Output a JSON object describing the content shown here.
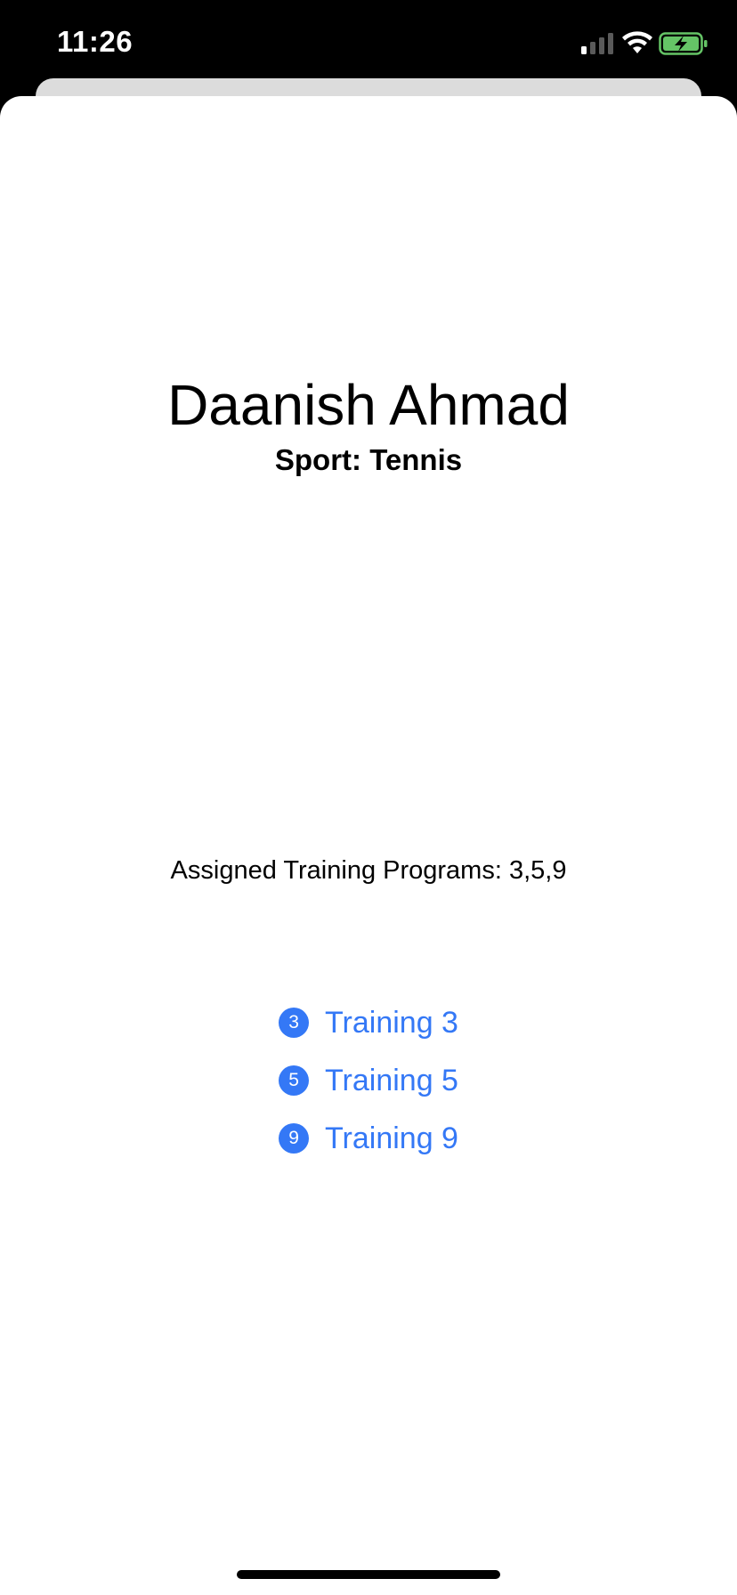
{
  "status_bar": {
    "time": "11:26",
    "icons": [
      "signal-icon",
      "wifi-icon",
      "battery-charging-icon"
    ],
    "battery_color": "#65c466"
  },
  "athlete": {
    "name": "Daanish Ahmad",
    "sport": "Sport: Tennis"
  },
  "training": {
    "assigned_label": "Assigned Training Programs: 3,5,9",
    "items": [
      {
        "number": "3",
        "label": "Training 3"
      },
      {
        "number": "5",
        "label": "Training 5"
      },
      {
        "number": "9",
        "label": "Training 9"
      }
    ]
  },
  "colors": {
    "accent": "#3478f6",
    "sheet_background": "#ffffff",
    "status_background": "#000000"
  }
}
